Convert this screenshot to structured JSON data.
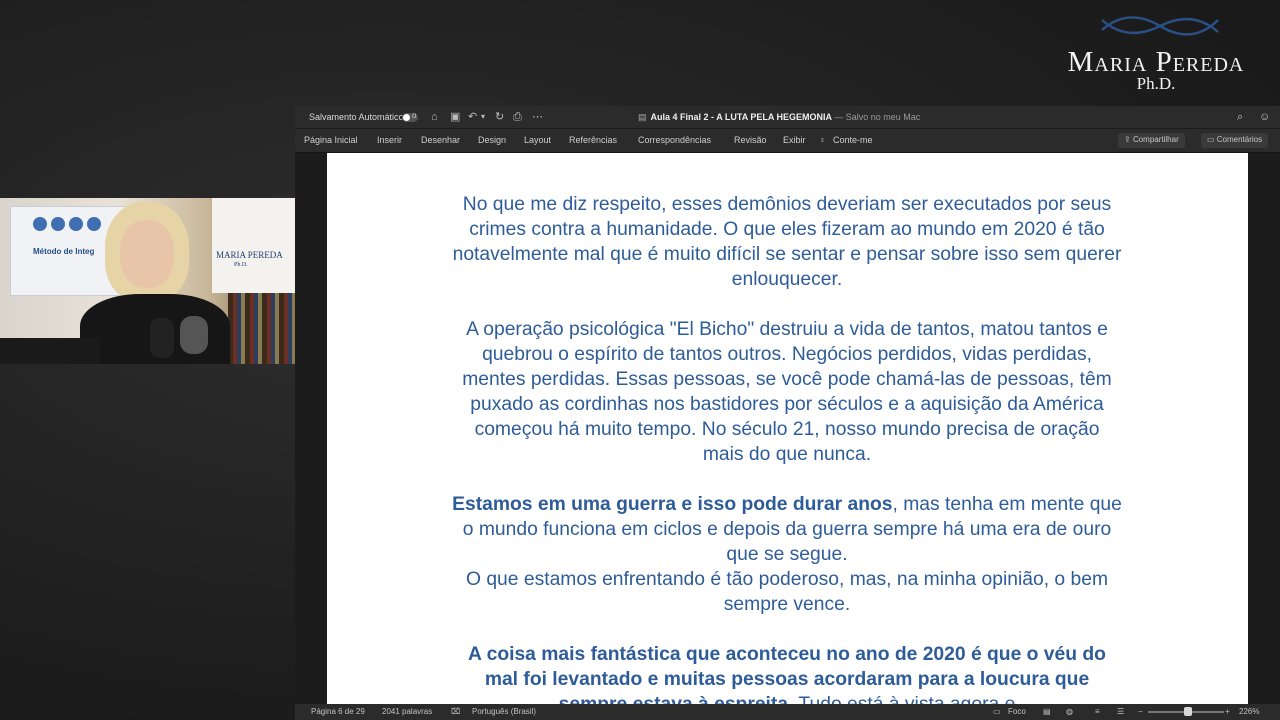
{
  "brand": {
    "name": "Maria Pereda",
    "suffix": "Ph.D."
  },
  "webcam": {
    "board_text": "Método de Integ",
    "poster_name": "MARIA PEREDA",
    "poster_suffix": "Ph.D."
  },
  "titlebar": {
    "autosave_label": "Salvamento Automático",
    "autosave_state": "o",
    "doc_name": "Aula 4 Final 2 -  A LUTA PELA HEGEMONIA",
    "saved_status": "— Salvo no meu Mac"
  },
  "ribbon": {
    "tabs": [
      "Página Inicial",
      "Inserir",
      "Desenhar",
      "Design",
      "Layout",
      "Referências",
      "Correspondências",
      "Revisão",
      "Exibir"
    ],
    "tell_me": "Conte-me",
    "share_label": "Compartilhar",
    "comments_label": "Comentários"
  },
  "document": {
    "p1": "No que me diz respeito, esses demônios deveriam ser executados por seus crimes contra a humanidade. O que eles fizeram ao mundo em 2020 é tão notavelmente mal que é muito difícil se sentar e pensar sobre isso sem querer enlouquecer.",
    "p2": "A operação psicológica \"El Bicho\" destruiu a vida de tantos, matou tantos e quebrou o espírito de tantos outros. Negócios perdidos, vidas perdidas, mentes perdidas. Essas pessoas, se você pode chamá-las de pessoas, têm puxado as cordinhas nos bastidores por séculos e a aquisição da América começou há muito tempo. No século 21, nosso mundo precisa de oração mais do que nunca.",
    "p3_bold": "Estamos em uma guerra e isso pode durar anos",
    "p3_rest": ", mas tenha em mente que o mundo funciona em ciclos e depois da guerra sempre há uma era de ouro que se segue.",
    "p3_line2": "O que estamos enfrentando é tão poderoso, mas, na minha opinião, o bem sempre vence.",
    "p4_bold": "A coisa mais fantástica que aconteceu no ano de 2020 é que o véu do mal foi levantado e muitas pessoas acordaram para a loucura que sempre estava à espreita.",
    "p4_rest": " Tudo está à vista agora e"
  },
  "statusbar": {
    "page": "Página 6 de 29",
    "words": "2041 palavras",
    "language": "Português (Brasil)",
    "focus": "Foco",
    "zoom": "226%",
    "zoom_level": 0.53
  },
  "colors": {
    "text_blue": "#2e5c99",
    "background": "#1e1e1e"
  }
}
